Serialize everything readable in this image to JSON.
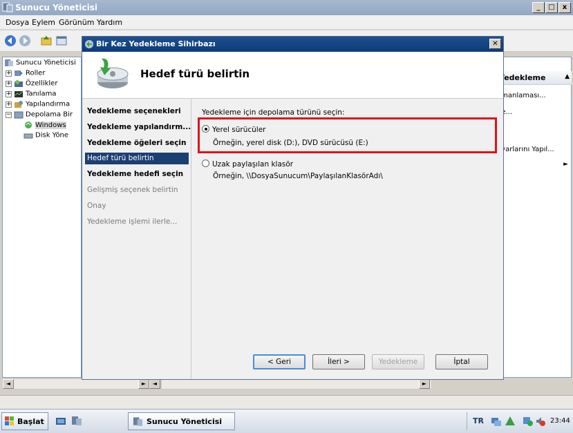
{
  "window": {
    "title": "Sunucu Yöneticisi",
    "controls": [
      "_",
      "□",
      "x"
    ]
  },
  "menu": [
    "Dosya",
    "Eylem",
    "Görünüm",
    "Yardım"
  ],
  "tree": [
    {
      "label": "Sunucu Yöneticisi",
      "expander": ""
    },
    {
      "label": "Roller",
      "expander": "+"
    },
    {
      "label": "Özellikler",
      "expander": "+"
    },
    {
      "label": "Tanılama",
      "expander": "+"
    },
    {
      "label": "Yapılandırma",
      "expander": "+"
    },
    {
      "label": "Depolama Bir",
      "expander": "−"
    },
    {
      "label": "Windows",
      "expander": ""
    },
    {
      "label": "Disk Yöne",
      "expander": ""
    }
  ],
  "actions": {
    "header": "r Yedekleme",
    "items": [
      "amanlaması...",
      "de...",
      "Ayarlarını Yapıl..."
    ]
  },
  "dialog": {
    "title": "Bir Kez Yedekleme Sihirbazı",
    "heading": "Hedef türü belirtin",
    "steps": [
      {
        "label": "Yedekleme seçenekleri",
        "state": "done"
      },
      {
        "label": "Yedekleme yapılandırm...",
        "state": "done"
      },
      {
        "label": "Yedekleme öğeleri seçin",
        "state": "done"
      },
      {
        "label": "Hedef türü belirtin",
        "state": "current"
      },
      {
        "label": "Yedekleme hedefi seçin",
        "state": "done"
      },
      {
        "label": "Gelişmiş seçenek belirtin",
        "state": "future"
      },
      {
        "label": "Onay",
        "state": "future"
      },
      {
        "label": "Yedekleme işlemi ilerle...",
        "state": "future"
      }
    ],
    "prompt": "Yedekleme için depolama türünü seçin:",
    "options": [
      {
        "label": "Yerel sürücüler",
        "desc": "Örneğin, yerel disk (D:), DVD sürücüsü (E:)",
        "selected": true
      },
      {
        "label": "Uzak paylaşılan klasör",
        "desc": "Örneğin, \\\\DosyaSunucum\\PaylaşılanKlasörAdı\\",
        "selected": false
      }
    ],
    "buttons": {
      "back": "< Geri",
      "next": "İleri >",
      "backup": "Yedekleme",
      "cancel": "İptal"
    }
  },
  "taskbar": {
    "start": "Başlat",
    "task": "Sunucu Yöneticisi",
    "lang": "TR",
    "clock": "23:44"
  },
  "colors": {
    "highlight": "#e0101a",
    "current_step": "#1c3f72",
    "dialog_title": "#0d3b7a"
  }
}
